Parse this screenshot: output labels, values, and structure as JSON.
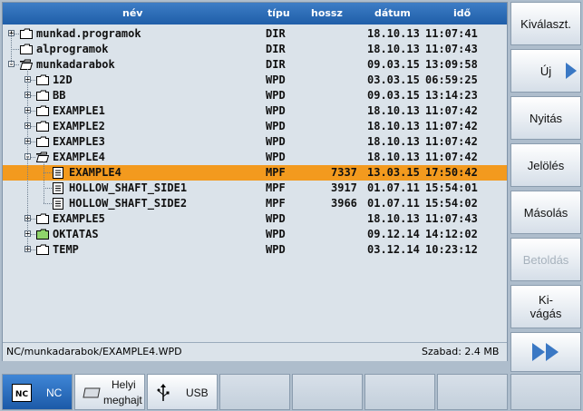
{
  "columns": {
    "name": "név",
    "type": "típu",
    "size": "hossz",
    "date": "dátum",
    "time": "idő"
  },
  "rows": [
    {
      "name": "munkad.programok",
      "type": "DIR",
      "size": "",
      "date": "18.10.13",
      "time": "11:07:41"
    },
    {
      "name": "alprogramok",
      "type": "DIR",
      "size": "",
      "date": "18.10.13",
      "time": "11:07:43"
    },
    {
      "name": "munkadarabok",
      "type": "DIR",
      "size": "",
      "date": "09.03.15",
      "time": "13:09:58"
    },
    {
      "name": "12D",
      "type": "WPD",
      "size": "",
      "date": "03.03.15",
      "time": "06:59:25"
    },
    {
      "name": "BB",
      "type": "WPD",
      "size": "",
      "date": "09.03.15",
      "time": "13:14:23"
    },
    {
      "name": "EXAMPLE1",
      "type": "WPD",
      "size": "",
      "date": "18.10.13",
      "time": "11:07:42"
    },
    {
      "name": "EXAMPLE2",
      "type": "WPD",
      "size": "",
      "date": "18.10.13",
      "time": "11:07:42"
    },
    {
      "name": "EXAMPLE3",
      "type": "WPD",
      "size": "",
      "date": "18.10.13",
      "time": "11:07:42"
    },
    {
      "name": "EXAMPLE4",
      "type": "WPD",
      "size": "",
      "date": "18.10.13",
      "time": "11:07:42"
    },
    {
      "name": "EXAMPLE4",
      "type": "MPF",
      "size": "7337",
      "date": "13.03.15",
      "time": "17:50:42"
    },
    {
      "name": "HOLLOW_SHAFT_SIDE1",
      "type": "MPF",
      "size": "3917",
      "date": "01.07.11",
      "time": "15:54:01"
    },
    {
      "name": "HOLLOW_SHAFT_SIDE2",
      "type": "MPF",
      "size": "3966",
      "date": "01.07.11",
      "time": "15:54:02"
    },
    {
      "name": "EXAMPLE5",
      "type": "WPD",
      "size": "",
      "date": "18.10.13",
      "time": "11:07:43"
    },
    {
      "name": "OKTATAS",
      "type": "WPD",
      "size": "",
      "date": "09.12.14",
      "time": "14:12:02"
    },
    {
      "name": "TEMP",
      "type": "WPD",
      "size": "",
      "date": "03.12.14",
      "time": "10:23:12"
    }
  ],
  "status": {
    "path": "NC/munkadarabok/EXAMPLE4.WPD",
    "free": "Szabad: 2.4 MB"
  },
  "softkeys_right": [
    "Kiválaszt.",
    "Új",
    "Nyitás",
    "Jelölés",
    "Másolás",
    "Betoldás",
    "Ki-vágás"
  ],
  "softkeys_right_ki": "Ki-",
  "softkeys_right_vagas": "vágás",
  "softkeys_bottom": {
    "nc": "NC",
    "local_1": "Helyi",
    "local_2": "meghajt",
    "usb": "USB"
  },
  "colors": {
    "header": "#2a6bb6",
    "selection": "#f39a1e",
    "panel": "#dbe3ea",
    "active_key": "#2a6ec0"
  }
}
